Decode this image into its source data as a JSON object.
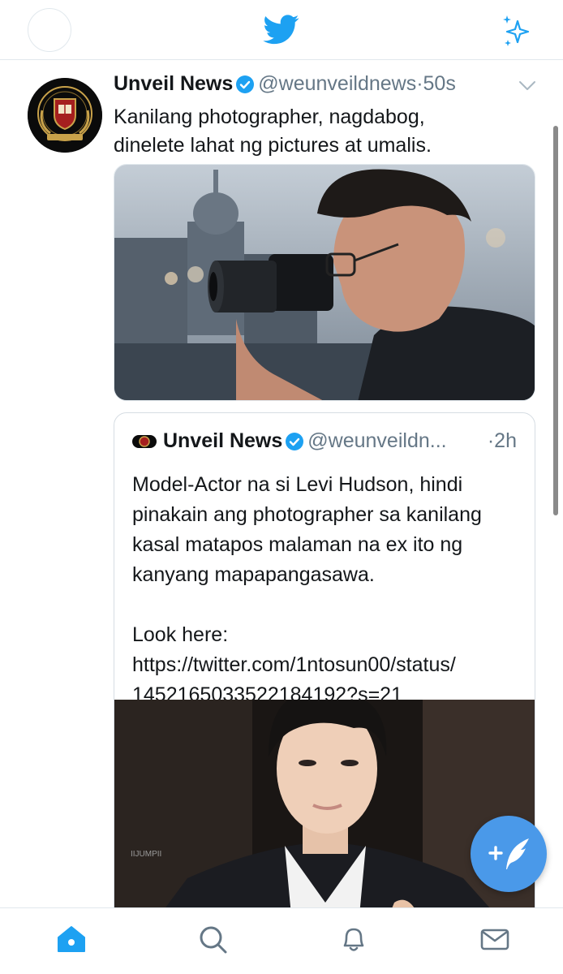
{
  "header": {
    "logo_icon": "twitter-bird-icon",
    "sparkle_icon": "sparkle-icon",
    "accent_color": "#1da1f2"
  },
  "tweet": {
    "display_name": "Unveil News",
    "verified": true,
    "handle": "@weunveildnews",
    "separator": "·",
    "time": "50s",
    "text_line1": "Kanilang photographer, nagdabog,",
    "text_line2": "dinelete lahat ng pictures at umalis.",
    "quoted": {
      "display_name": "Unveil News",
      "handle": "@weunveildn...",
      "time": "·2h",
      "lines": [
        "Model-Actor na si Levi Hudson, hindi",
        "pinakain ang photographer sa kanilang",
        "kasal matapos malaman na ex ito ng",
        "kanyang mapapangasawa.",
        "",
        "Look here:",
        "https://twitter.com/1ntosun00/status/",
        "1452165033522184192?s=21"
      ],
      "watermark": "IIJUMPII"
    }
  },
  "fab": {
    "icon": "compose-tweet-icon",
    "color": "#4a99e9"
  },
  "tabs": [
    {
      "name": "home",
      "icon": "home-icon",
      "active": true
    },
    {
      "name": "search",
      "icon": "search-icon",
      "active": false
    },
    {
      "name": "notifications",
      "icon": "bell-icon",
      "active": false
    },
    {
      "name": "messages",
      "icon": "mail-icon",
      "active": false
    }
  ]
}
